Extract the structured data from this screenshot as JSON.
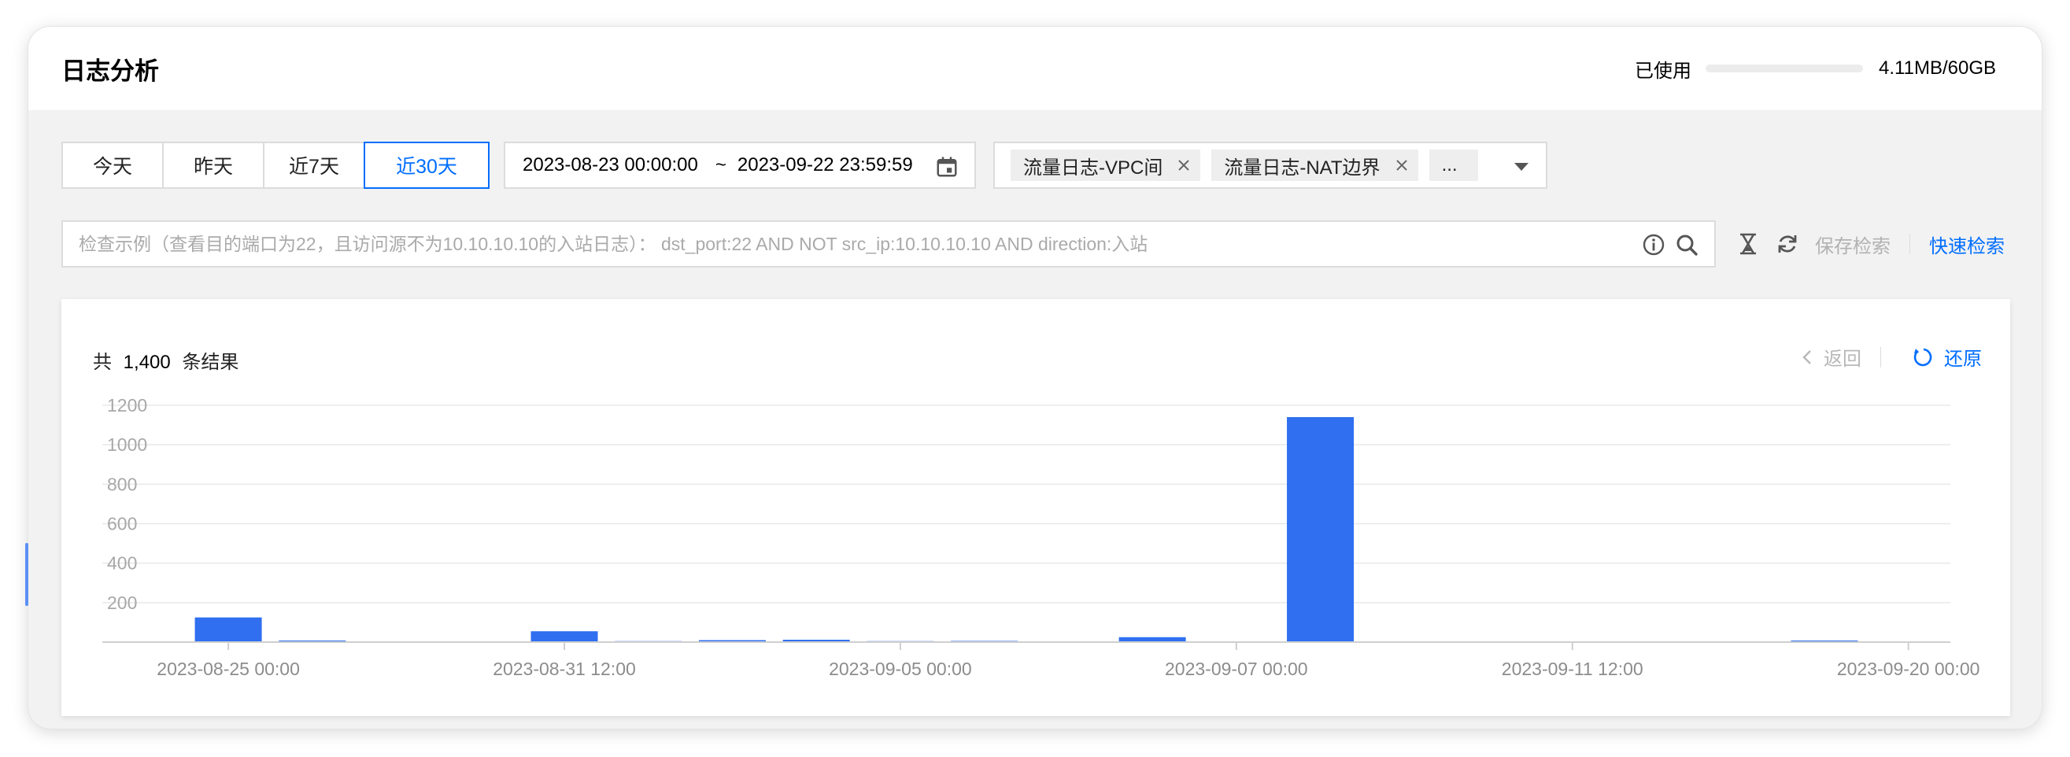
{
  "header": {
    "title": "日志分析",
    "usage_label": "已使用",
    "usage_value": "4.11MB/60GB",
    "usage_fraction": 0.0001
  },
  "date_tabs": [
    "今天",
    "昨天",
    "近7天",
    "近30天"
  ],
  "active_date_tab": 3,
  "date_range": {
    "start": "2023-08-23 00:00:00",
    "separator": "~",
    "end": "2023-09-22 23:59:59"
  },
  "log_tags": [
    "流量日志-VPC间",
    "流量日志-NAT边界"
  ],
  "log_tags_more": "...",
  "search": {
    "placeholder": "检查示例（查看目的端口为22，且访问源不为10.10.10.10的入站日志）： dst_port:22 AND NOT src_ip:10.10.10.10 AND direction:入站",
    "value": ""
  },
  "actions": {
    "save_search": "保存检索",
    "quick_search": "快速检索"
  },
  "result": {
    "prefix": "共",
    "count": "1,400",
    "suffix": "条结果",
    "back": "返回",
    "restore": "还原"
  },
  "colors": {
    "accent": "#006eff",
    "bar": "#2f6ff0"
  },
  "chart_data": {
    "type": "bar",
    "x_tick_labels": [
      "2023-08-25 00:00",
      "2023-08-31 12:00",
      "2023-09-05 00:00",
      "2023-09-07 00:00",
      "2023-09-11 12:00",
      "2023-09-20 00:00"
    ],
    "bar_slots": 22,
    "values": [
      0,
      125,
      8,
      0,
      0,
      55,
      5,
      10,
      12,
      5,
      6,
      0,
      25,
      0,
      1140,
      0,
      0,
      0,
      0,
      3,
      8,
      0
    ],
    "yticks": [
      200,
      400,
      600,
      800,
      1000,
      1200
    ],
    "ylim": [
      0,
      1200
    ],
    "grid": true
  }
}
